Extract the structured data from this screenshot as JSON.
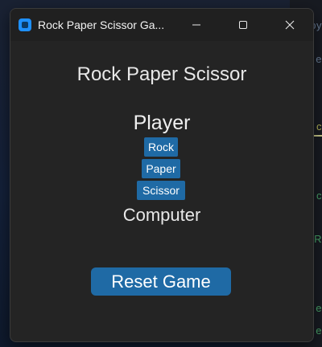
{
  "window": {
    "title": "Rock Paper Scissor Ga..."
  },
  "main": {
    "heading": "Rock Paper Scissor",
    "player_label": "Player",
    "choices": [
      {
        "label": "Rock"
      },
      {
        "label": "Paper"
      },
      {
        "label": "Scissor"
      }
    ],
    "computer_label": "Computer",
    "reset_label": "Reset Game"
  },
  "background": {
    "fragments": [
      "py",
      "e",
      "c",
      "c",
      "R",
      "e",
      "e"
    ]
  },
  "colors": {
    "window_bg": "#242424",
    "titlebar_bg": "#202020",
    "button_blue": "#1f6aa5",
    "app_icon": "#1e90ff",
    "text_light": "#e8e8e8"
  },
  "icons": {
    "app": "app-icon",
    "minimize": "minimize-icon",
    "maximize": "maximize-icon",
    "close": "close-icon"
  }
}
